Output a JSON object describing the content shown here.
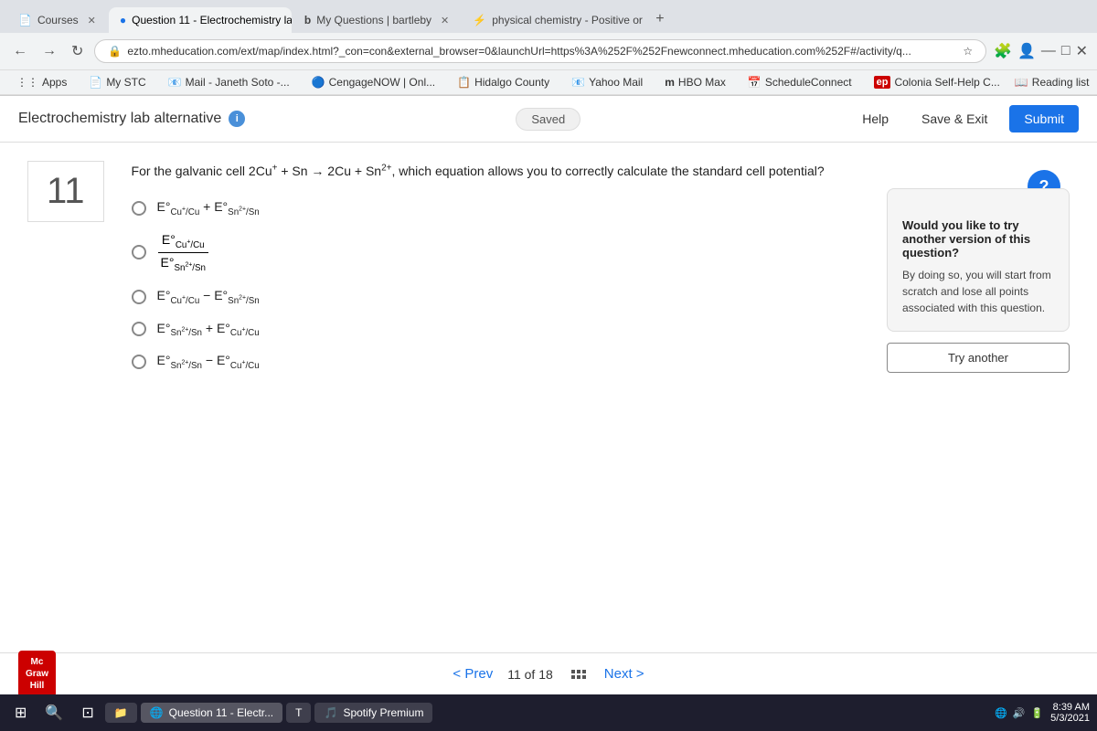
{
  "browser": {
    "tabs": [
      {
        "id": "courses",
        "label": "Courses",
        "active": false,
        "favicon": "📄"
      },
      {
        "id": "question11",
        "label": "Question 11 - Electrochemistry la...",
        "active": true,
        "favicon": "🔵"
      },
      {
        "id": "myquestions",
        "label": "My Questions | bartleby",
        "active": false,
        "favicon": "b"
      },
      {
        "id": "physicalchem",
        "label": "physical chemistry - Positive or N...",
        "active": false,
        "favicon": "⚡"
      }
    ],
    "address": "ezto.mheducation.com/ext/map/index.html?_con=con&external_browser=0&launchUrl=https%3A%252F%252Fnewconnect.mheducation.com%252F#/activity/q...",
    "bookmarks": [
      {
        "label": "Apps"
      },
      {
        "label": "My STC",
        "icon": "📄"
      },
      {
        "label": "Mail - Janeth Soto -...",
        "icon": "📧"
      },
      {
        "label": "CengageNOW | Onl...",
        "icon": "🔵"
      },
      {
        "label": "Hidalgo County",
        "icon": "📋"
      },
      {
        "label": "Yahoo Mail",
        "icon": "📧"
      },
      {
        "label": "HBO Max",
        "icon": "m"
      },
      {
        "label": "ScheduleConnect",
        "icon": "📅"
      },
      {
        "label": "Colonia Self-Help C...",
        "icon": "ep"
      }
    ],
    "reading_list": "Reading list"
  },
  "app": {
    "title": "Electrochemistry lab alternative",
    "saved_label": "Saved",
    "help_btn": "Help",
    "save_exit_btn": "Save & Exit",
    "submit_btn": "Submit"
  },
  "question": {
    "number": "11",
    "text_parts": {
      "full": "For the galvanic cell 2Cu⁺ + Sn → 2Cu + Sn²⁺, which equation allows you to correctly calculate the standard cell potential?"
    },
    "options": [
      {
        "id": "a",
        "type": "inline",
        "html": "E°<sub>Cu⁺/Cu</sub> + E°<sub>Sn²⁺/Sn</sub>"
      },
      {
        "id": "b",
        "type": "fraction",
        "numerator_html": "E°<sub>Cu⁺/Cu</sub>",
        "denominator_html": "E°<sub>Sn²⁺/Sn</sub>"
      },
      {
        "id": "c",
        "type": "inline",
        "html": "E°<sub>Cu⁺/Cu</sub> − E°<sub>Sn²⁺/Sn</sub>"
      },
      {
        "id": "d",
        "type": "inline",
        "html": "E°<sub>Sn²⁺/Sn</sub> + E°<sub>Cu⁺/Cu</sub>"
      },
      {
        "id": "e",
        "type": "inline",
        "html": "E°<sub>Sn²⁺/Sn</sub> − E°<sub>Cu⁺/Cu</sub>"
      }
    ]
  },
  "sidebar": {
    "help_title": "Would you like to try another version of this question?",
    "help_body": "By doing so, you will start from scratch and lose all points associated with this question.",
    "try_another_btn": "Try another"
  },
  "footer": {
    "logo_line1": "Mc",
    "logo_line2": "Graw",
    "logo_line3": "Hill",
    "prev_label": "Prev",
    "current_page": "11",
    "total_pages": "18",
    "of_label": "of",
    "next_label": "Next"
  },
  "taskbar": {
    "time": "8:39 AM",
    "date": "5/3/2021",
    "active_app": "Question 11 - Electr..."
  }
}
